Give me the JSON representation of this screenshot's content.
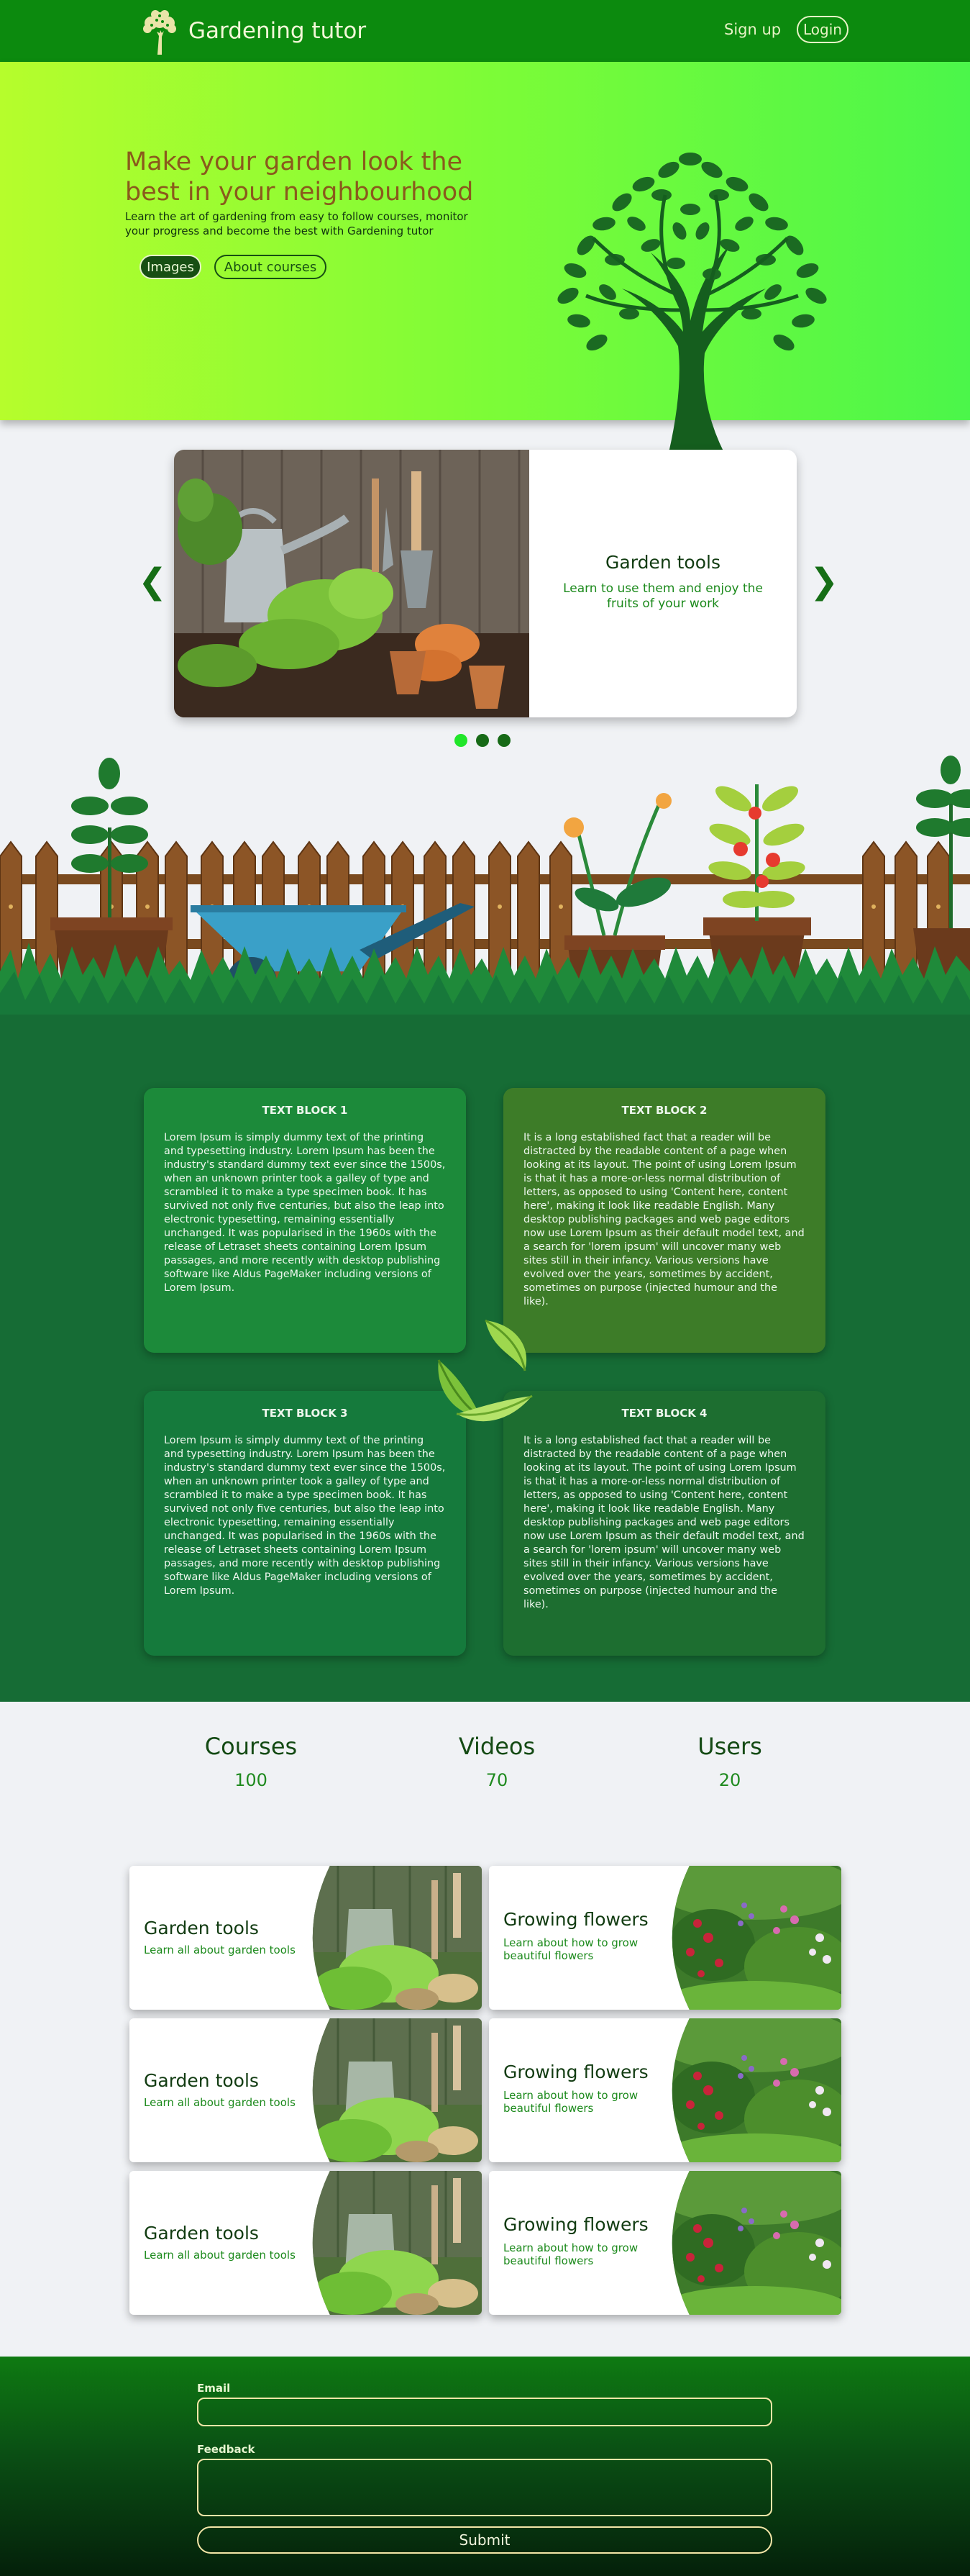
{
  "nav": {
    "brand": "Gardening tutor",
    "signup": "Sign up",
    "login": "Login"
  },
  "hero": {
    "title": "Make your garden look the best in your neighbourhood",
    "subtitle": "Learn the art of gardening from easy to follow courses, monitor your progress and become the best with Gardening tutor",
    "images_button": "Images",
    "about_button": "About courses"
  },
  "carousel": {
    "title": "Garden tools",
    "text": "Learn to use them and enjoy the fruits of your work",
    "prev": "❮",
    "next": "❯",
    "active_slide": 1,
    "slide_count": 3
  },
  "text_blocks": [
    {
      "title": "TEXT BLOCK 1",
      "body": "Lorem Ipsum is simply dummy text of the printing and typesetting industry. Lorem Ipsum has been the industry's standard dummy text ever since the 1500s, when an unknown printer took a galley of type and scrambled it to make a type specimen book. It has survived not only five centuries, but also the leap into electronic typesetting, remaining essentially unchanged. It was popularised in the 1960s with the release of Letraset sheets containing Lorem Ipsum passages, and more recently with desktop publishing software like Aldus PageMaker including versions of Lorem Ipsum."
    },
    {
      "title": "TEXT BLOCK 2",
      "body": "It is a long established fact that a reader will be distracted by the readable content of a page when looking at its layout. The point of using Lorem Ipsum is that it has a more-or-less normal distribution of letters, as opposed to using 'Content here, content here', making it look like readable English. Many desktop publishing packages and web page editors now use Lorem Ipsum as their default model text, and a search for 'lorem ipsum' will uncover many web sites still in their infancy. Various versions have evolved over the years, sometimes by accident, sometimes on purpose (injected humour and the like)."
    },
    {
      "title": "TEXT BLOCK 3",
      "body": "Lorem Ipsum is simply dummy text of the printing and typesetting industry. Lorem Ipsum has been the industry's standard dummy text ever since the 1500s, when an unknown printer took a galley of type and scrambled it to make a type specimen book. It has survived not only five centuries, but also the leap into electronic typesetting, remaining essentially unchanged. It was popularised in the 1960s with the release of Letraset sheets containing Lorem Ipsum passages, and more recently with desktop publishing software like Aldus PageMaker including versions of Lorem Ipsum."
    },
    {
      "title": "TEXT BLOCK 4",
      "body": "It is a long established fact that a reader will be distracted by the readable content of a page when looking at its layout. The point of using Lorem Ipsum is that it has a more-or-less normal distribution of letters, as opposed to using 'Content here, content here', making it look like readable English. Many desktop publishing packages and web page editors now use Lorem Ipsum as their default model text, and a search for 'lorem ipsum' will uncover many web sites still in their infancy. Various versions have evolved over the years, sometimes by accident, sometimes on purpose (injected humour and the like)."
    }
  ],
  "stats": [
    {
      "label": "Courses",
      "value": "100"
    },
    {
      "label": "Videos",
      "value": "70"
    },
    {
      "label": "Users",
      "value": "20"
    }
  ],
  "cards": [
    {
      "title": "Garden tools",
      "text": "Learn all about garden tools"
    },
    {
      "title": "Growing flowers",
      "text": "Learn about how to grow beautiful flowers"
    },
    {
      "title": "Garden tools",
      "text": "Learn all about garden tools"
    },
    {
      "title": "Growing flowers",
      "text": "Learn about how to grow beautiful flowers"
    },
    {
      "title": "Garden tools",
      "text": "Learn all about garden tools"
    },
    {
      "title": "Growing flowers",
      "text": "Learn about how to grow beautiful flowers"
    }
  ],
  "form": {
    "email_label": "Email",
    "feedback_label": "Feedback",
    "submit": "Submit"
  },
  "colors": {
    "nav": "#0c8a0e",
    "accent_dark": "#174f13",
    "text_blocks_bg": "#166c35",
    "hero_title": "#8a5a1c"
  },
  "icons": [
    "tree-logo-icon",
    "tree-illustration-icon",
    "chevron-left-icon",
    "chevron-right-icon",
    "recycle-leaves-icon"
  ]
}
